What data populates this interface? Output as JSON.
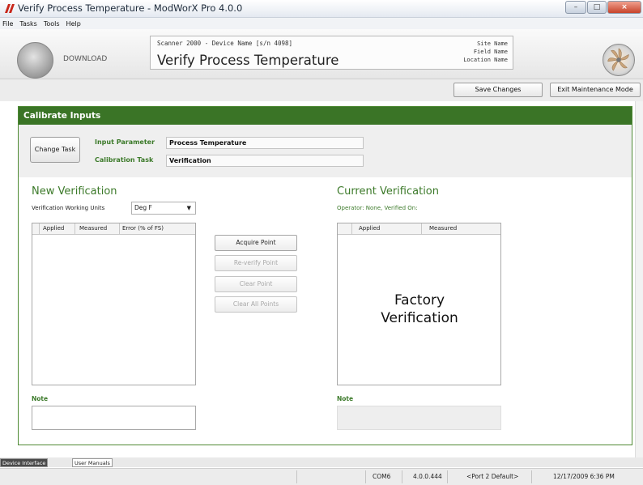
{
  "window": {
    "title": "Verify Process Temperature - ModWorX Pro 4.0.0"
  },
  "menu": [
    "File",
    "Tasks",
    "Tools",
    "Help"
  ],
  "header": {
    "download_label": "DOWNLOAD",
    "device_line": "Scanner 2000 - Device Name [s/n 4098]",
    "task_title": "Verify Process Temperature",
    "site_name": "Site Name",
    "field_name": "Field Name",
    "location_name": "Location Name"
  },
  "toolbar": {
    "save_label": "Save Changes",
    "exit_label": "Exit Maintenance Mode"
  },
  "panel": {
    "title": "Calibrate Inputs",
    "change_task_label": "Change Task",
    "input_param_label": "Input Parameter",
    "input_param_value": "Process Temperature",
    "cal_task_label": "Calibration Task",
    "cal_task_value": "Verification"
  },
  "new_verification": {
    "title": "New Verification",
    "units_label": "Verification Working Units",
    "units_value": "Deg F",
    "columns": [
      "Applied",
      "Measured",
      "Error (% of FS)"
    ],
    "note_label": "Note"
  },
  "actions": {
    "acquire": "Acquire Point",
    "reverify": "Re-verify Point",
    "clear": "Clear Point",
    "clear_all": "Clear All Points"
  },
  "current_verification": {
    "title": "Current Verification",
    "operator_text": "Operator: None, Verified On:",
    "columns": [
      "Applied",
      "Measured"
    ],
    "factory_line1": "Factory",
    "factory_line2": "Verification",
    "note_label": "Note"
  },
  "bottom_tabs": [
    "Device Interface",
    "User Manuals"
  ],
  "status": {
    "port": "COM6",
    "version": "4.0.0.444",
    "port_default": "<Port 2 Default>",
    "datetime": "12/17/2009 6:36 PM"
  },
  "colors": {
    "accent_green": "#3a7426",
    "label_green": "#3c7a2a"
  },
  "icons": [
    "app-logo-icon",
    "download-circle-icon",
    "fan-icon",
    "dropdown-arrow-icon"
  ]
}
